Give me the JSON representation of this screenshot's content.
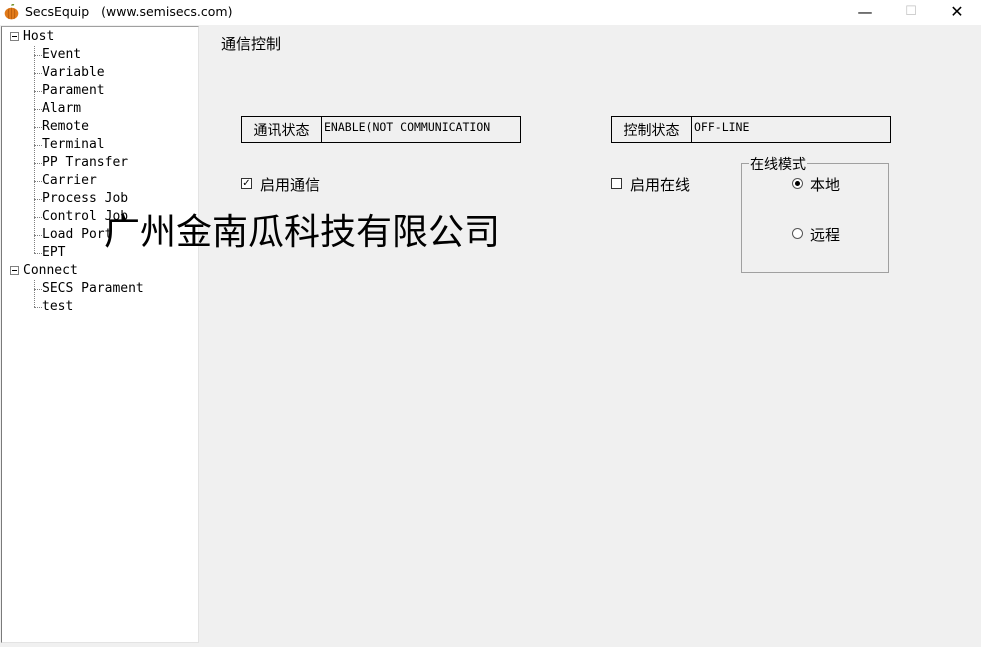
{
  "window": {
    "title": "SecsEquip   (www.semisecs.com)",
    "controls": {
      "minimize": "—",
      "maximize": "☐",
      "close": "✕"
    }
  },
  "tree": {
    "groups": [
      {
        "label": "Host",
        "expanded": true,
        "children": [
          "Event",
          "Variable",
          "Parament",
          "Alarm",
          "Remote",
          "Terminal",
          "PP Transfer",
          "Carrier",
          "Process Job",
          "Control Job",
          "Load Port",
          "EPT"
        ]
      },
      {
        "label": "Connect",
        "expanded": true,
        "children": [
          "SECS Parament",
          "test"
        ]
      }
    ]
  },
  "main": {
    "section_title": "通信控制",
    "comm_status": {
      "label": "通讯状态",
      "value": "ENABLE(NOT COMMUNICATION"
    },
    "control_status": {
      "label": "控制状态",
      "value": "OFF-LINE"
    },
    "enable_comm": {
      "label": "启用通信",
      "checked": true
    },
    "enable_online": {
      "label": "启用在线",
      "checked": false
    },
    "online_mode": {
      "title": "在线模式",
      "options": [
        {
          "label": "本地",
          "selected": true
        },
        {
          "label": "远程",
          "selected": false
        }
      ]
    }
  },
  "watermark": "广州金南瓜科技有限公司"
}
